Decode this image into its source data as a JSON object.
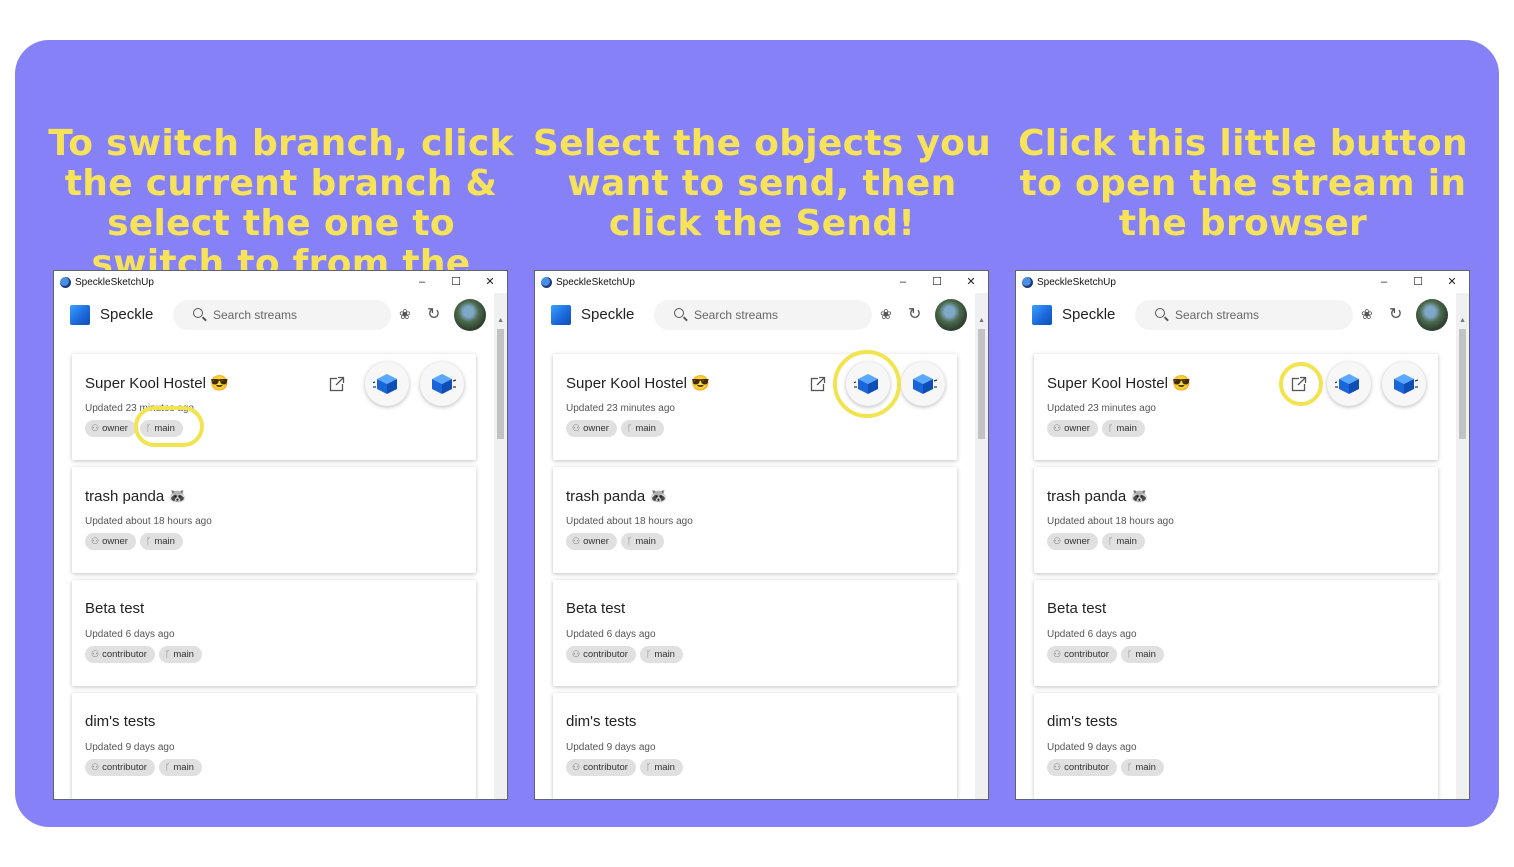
{
  "captions": [
    "To switch branch, click the current branch & select the one to switch to from the drop down",
    "Select the objects you want to send, then click the Send!",
    "Click this little button to open the stream in the browser"
  ],
  "window": {
    "title": "SpeckleSketchUp",
    "minimize": "–",
    "maximize": "☐",
    "close": "✕"
  },
  "app": {
    "logo_text": "Speckle",
    "search_placeholder": "Search streams",
    "wand_icon": "❀",
    "refresh_icon": "↻"
  },
  "streams": [
    {
      "title": "Super Kool Hostel 😎",
      "updated": "Updated 23 minutes ago",
      "role": "owner",
      "branch": "main"
    },
    {
      "title": "trash panda 🦝",
      "updated": "Updated about 18 hours ago",
      "role": "owner",
      "branch": "main"
    },
    {
      "title": "Beta test",
      "updated": "Updated 6 days ago",
      "role": "contributor",
      "branch": "main"
    },
    {
      "title": "dim's tests",
      "updated": "Updated 9 days ago",
      "role": "contributor",
      "branch": "main"
    }
  ],
  "colors": {
    "background": "#8681f6",
    "caption": "#f6e35a",
    "highlight_ring": "#f2e350",
    "accent_blue": "#1a66d9"
  },
  "icons": {
    "role": "account-group-icon",
    "branch": "source-branch-icon",
    "open": "open-in-new-icon",
    "send": "send-cube-icon",
    "receive": "receive-cube-icon"
  },
  "highlights": [
    "branch-chip",
    "send-button",
    "open-in-browser-button"
  ]
}
